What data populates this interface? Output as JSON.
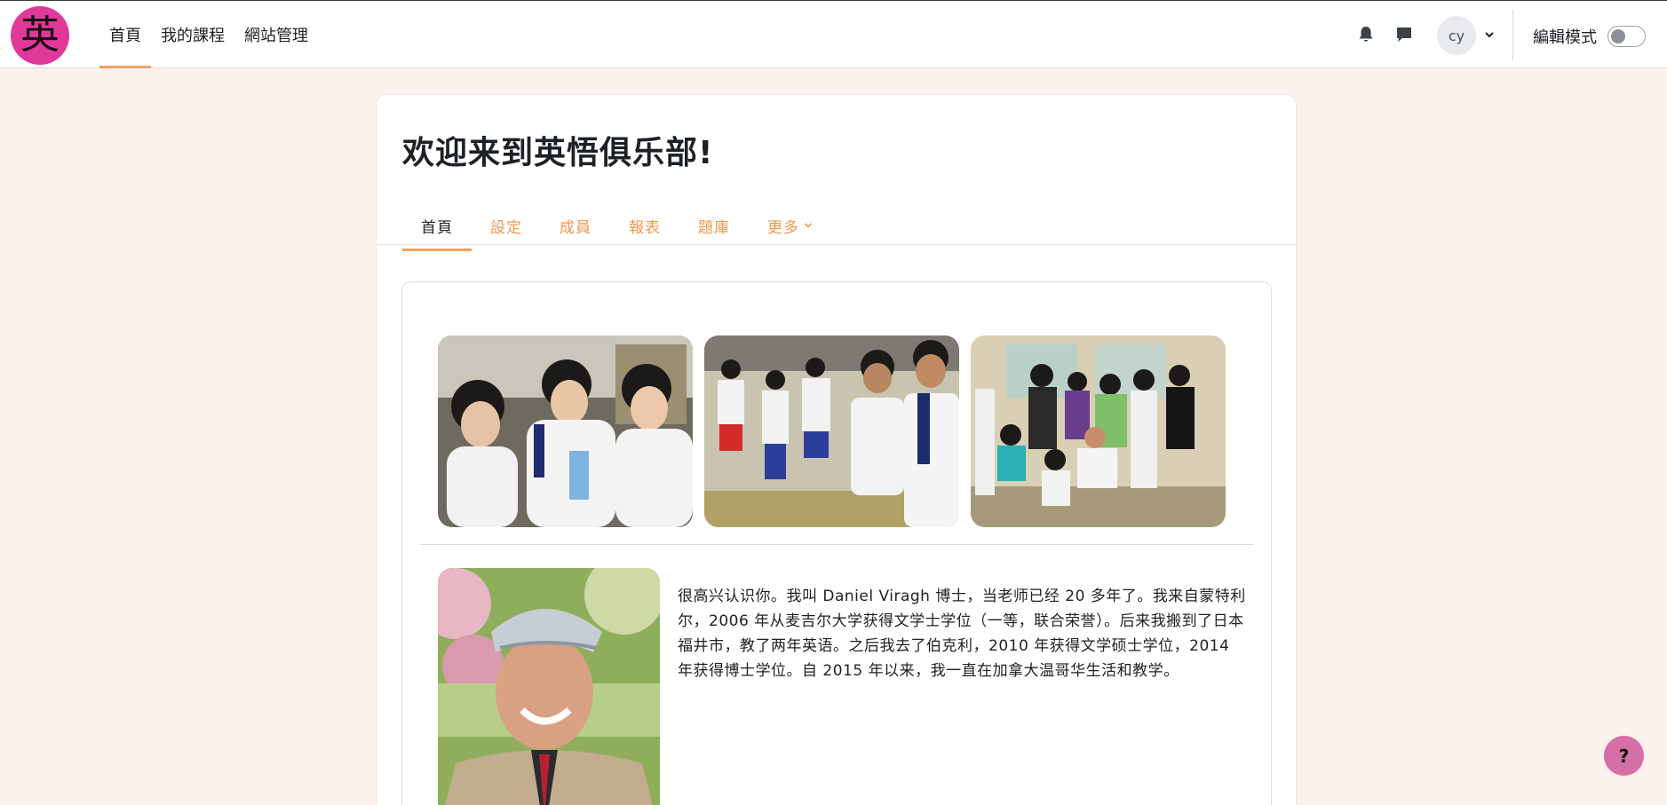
{
  "header": {
    "logo_glyph": "英",
    "nav": [
      {
        "label": "首頁",
        "active": true
      },
      {
        "label": "我的課程",
        "active": false
      },
      {
        "label": "網站管理",
        "active": false
      }
    ],
    "notifications_icon": "bell-icon",
    "messages_icon": "chat-bubble-icon",
    "user_initials": "cy",
    "edit_mode_label": "編輯模式",
    "edit_mode_on": false
  },
  "page": {
    "title": "欢迎来到英悟俱乐部!",
    "tabs": [
      {
        "label": "首頁",
        "active": true
      },
      {
        "label": "設定",
        "active": false
      },
      {
        "label": "成員",
        "active": false
      },
      {
        "label": "報表",
        "active": false
      },
      {
        "label": "題庫",
        "active": false
      },
      {
        "label": "更多",
        "active": false
      }
    ]
  },
  "content": {
    "bio": "很高兴认识你。我叫 Daniel Viragh 博士，当老师已经 20 多年了。我来自蒙特利尔，2006 年从麦吉尔大学获得文学士学位（一等，联合荣誉）。后来我搬到了日本福井市，教了两年英语。之后我去了伯克利，2010 年获得文学硕士学位，2014 年获得博士学位。自 2015 年以来，我一直在加拿大温哥华生活和教学。"
  },
  "help_label": "?",
  "colors": {
    "accent": "#f0a160",
    "tab_link": "#f0984e",
    "logo_bg": "#e0399a",
    "help_bg": "#d470a6",
    "page_bg": "#fdf1ee"
  }
}
